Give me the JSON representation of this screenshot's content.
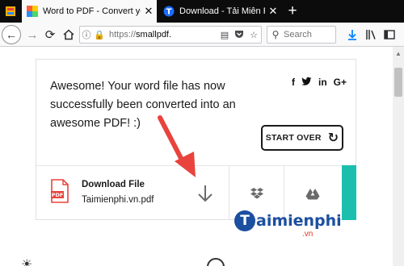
{
  "browser": {
    "tabs": [
      {
        "title": "Word to PDF - Convert your DO",
        "active": true
      },
      {
        "title": "Download - Tải Miễn Phí VN",
        "active": false
      }
    ],
    "new_tab_label": "+",
    "url": {
      "scheme": "https://",
      "host": "smallpdf."
    },
    "search": {
      "placeholder": "Search"
    }
  },
  "result_card": {
    "message": "Awesome! Your word file has now successfully been converted into an awesome PDF! :)",
    "social": [
      "f",
      "t",
      "in",
      "G+"
    ],
    "start_over_label": "START OVER"
  },
  "download": {
    "title": "Download File",
    "filename": "Taimienphi.vn.pdf"
  },
  "watermark": {
    "logo_text": "aimienphi",
    "logo_initial": "T",
    "suffix": ".vn"
  },
  "colors": {
    "accent_teal": "#1cbfae",
    "arrow_red": "#e8433c",
    "pdf_red": "#e8433c",
    "watermark_blue": "#1b4fa0"
  },
  "icons": [
    "back-icon",
    "forward-icon",
    "reload-icon",
    "home-icon",
    "info-icon",
    "lock-icon",
    "reader-icon",
    "pocket-icon",
    "bookmark-star-icon",
    "search-icon",
    "download-toolbar-icon",
    "library-icon",
    "sidebar-icon",
    "pdf-file-icon",
    "download-arrow-icon",
    "dropbox-icon",
    "google-drive-icon",
    "refresh-icon"
  ]
}
